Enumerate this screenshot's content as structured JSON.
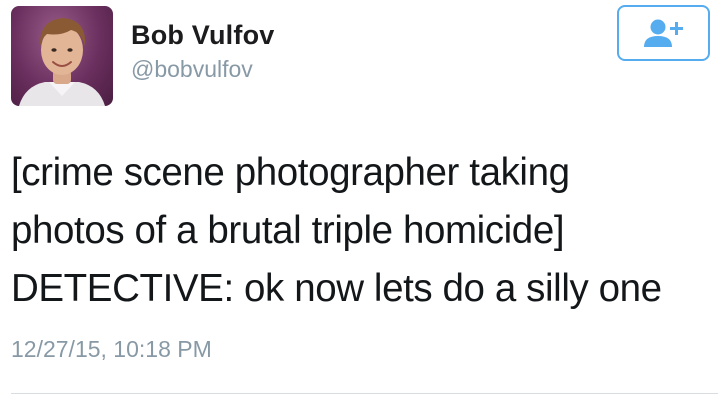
{
  "author": {
    "display_name": "Bob Vulfov",
    "handle": "@bobvulfov",
    "avatar_icon": "profile-photo"
  },
  "follow_button": {
    "icon": "follow-person-plus-icon",
    "accent_color": "#55acee"
  },
  "tweet": {
    "lines": [
      "[crime scene photographer taking",
      "photos of a brutal triple homicide]",
      "DETECTIVE: ok now lets do a silly one"
    ],
    "timestamp": "12/27/15, 10:18 PM"
  },
  "colors": {
    "name": "#1c1c1e",
    "secondary_text": "#8899a6",
    "body_text": "#14171a",
    "divider": "#d8dde2"
  }
}
